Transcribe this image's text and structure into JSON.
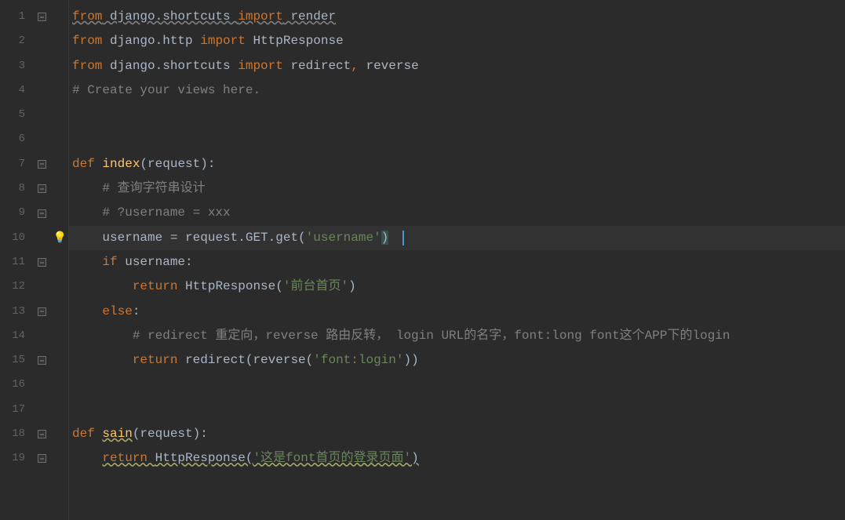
{
  "lines": {
    "count": 19,
    "numbers": [
      "1",
      "2",
      "3",
      "4",
      "5",
      "6",
      "7",
      "8",
      "9",
      "10",
      "11",
      "12",
      "13",
      "14",
      "15",
      "16",
      "17",
      "18",
      "19"
    ]
  },
  "tokens": {
    "l1_from": "from",
    "l1_mod": " django.shortcuts ",
    "l1_imp": "import",
    "l1_ren": " render",
    "l2_from": "from",
    "l2_mod": " django.http ",
    "l2_imp": "import",
    "l2_http": " HttpResponse",
    "l3_from": "from",
    "l3_mod": " django.shortcuts ",
    "l3_imp": "import",
    "l3_red": " redirect",
    "l3_comma": ", ",
    "l3_rev": "reverse",
    "l4_cmt": "# Create your views here.",
    "l7_def": "def ",
    "l7_name": "index",
    "l7_paren_open": "(",
    "l7_arg": "request",
    "l7_paren_close_colon": "):",
    "l8_cmt": "# 查询字符串设计",
    "l9_cmt": "# ?username = xxx",
    "l10_lhs": "username ",
    "l10_eq": "= ",
    "l10_rhs1": "request.GET.get(",
    "l10_str": "'username'",
    "l10_close": ")",
    "l11_if": "if ",
    "l11_var": "username",
    "l11_colon": ":",
    "l12_ret": "return ",
    "l12_call": "HttpResponse(",
    "l12_str": "'前台首页'",
    "l12_close": ")",
    "l13_else": "else",
    "l13_colon": ":",
    "l14_cmt": "# redirect 重定向，reverse 路由反转， login URL的名字，font:long font这个APP下的login",
    "l15_ret": "return ",
    "l15_redir": "redirect(reverse(",
    "l15_str": "'font:login'",
    "l15_close": "))",
    "l18_def": "def ",
    "l18_name": "sain",
    "l18_paren_open": "(",
    "l18_arg": "request",
    "l18_paren_close_colon": "):",
    "l19_ret": "return ",
    "l19_call": "HttpResponse(",
    "l19_str": "'这是font首页的登录页面'",
    "l19_close": ")"
  },
  "hints": {
    "bulb_line": 10,
    "bulb_glyph": "💡"
  },
  "fold_markers_at": [
    1,
    7,
    8,
    9,
    11,
    13,
    15,
    18,
    19
  ],
  "highlight_line": 10,
  "colors": {
    "bg": "#2b2b2b",
    "fg": "#a9b7c6",
    "keyword": "#cc7832",
    "string": "#6a8759",
    "comment": "#808080",
    "func": "#ffc66d",
    "linenum": "#606366",
    "highlight": "#323232",
    "caret": "#4e96c6"
  }
}
